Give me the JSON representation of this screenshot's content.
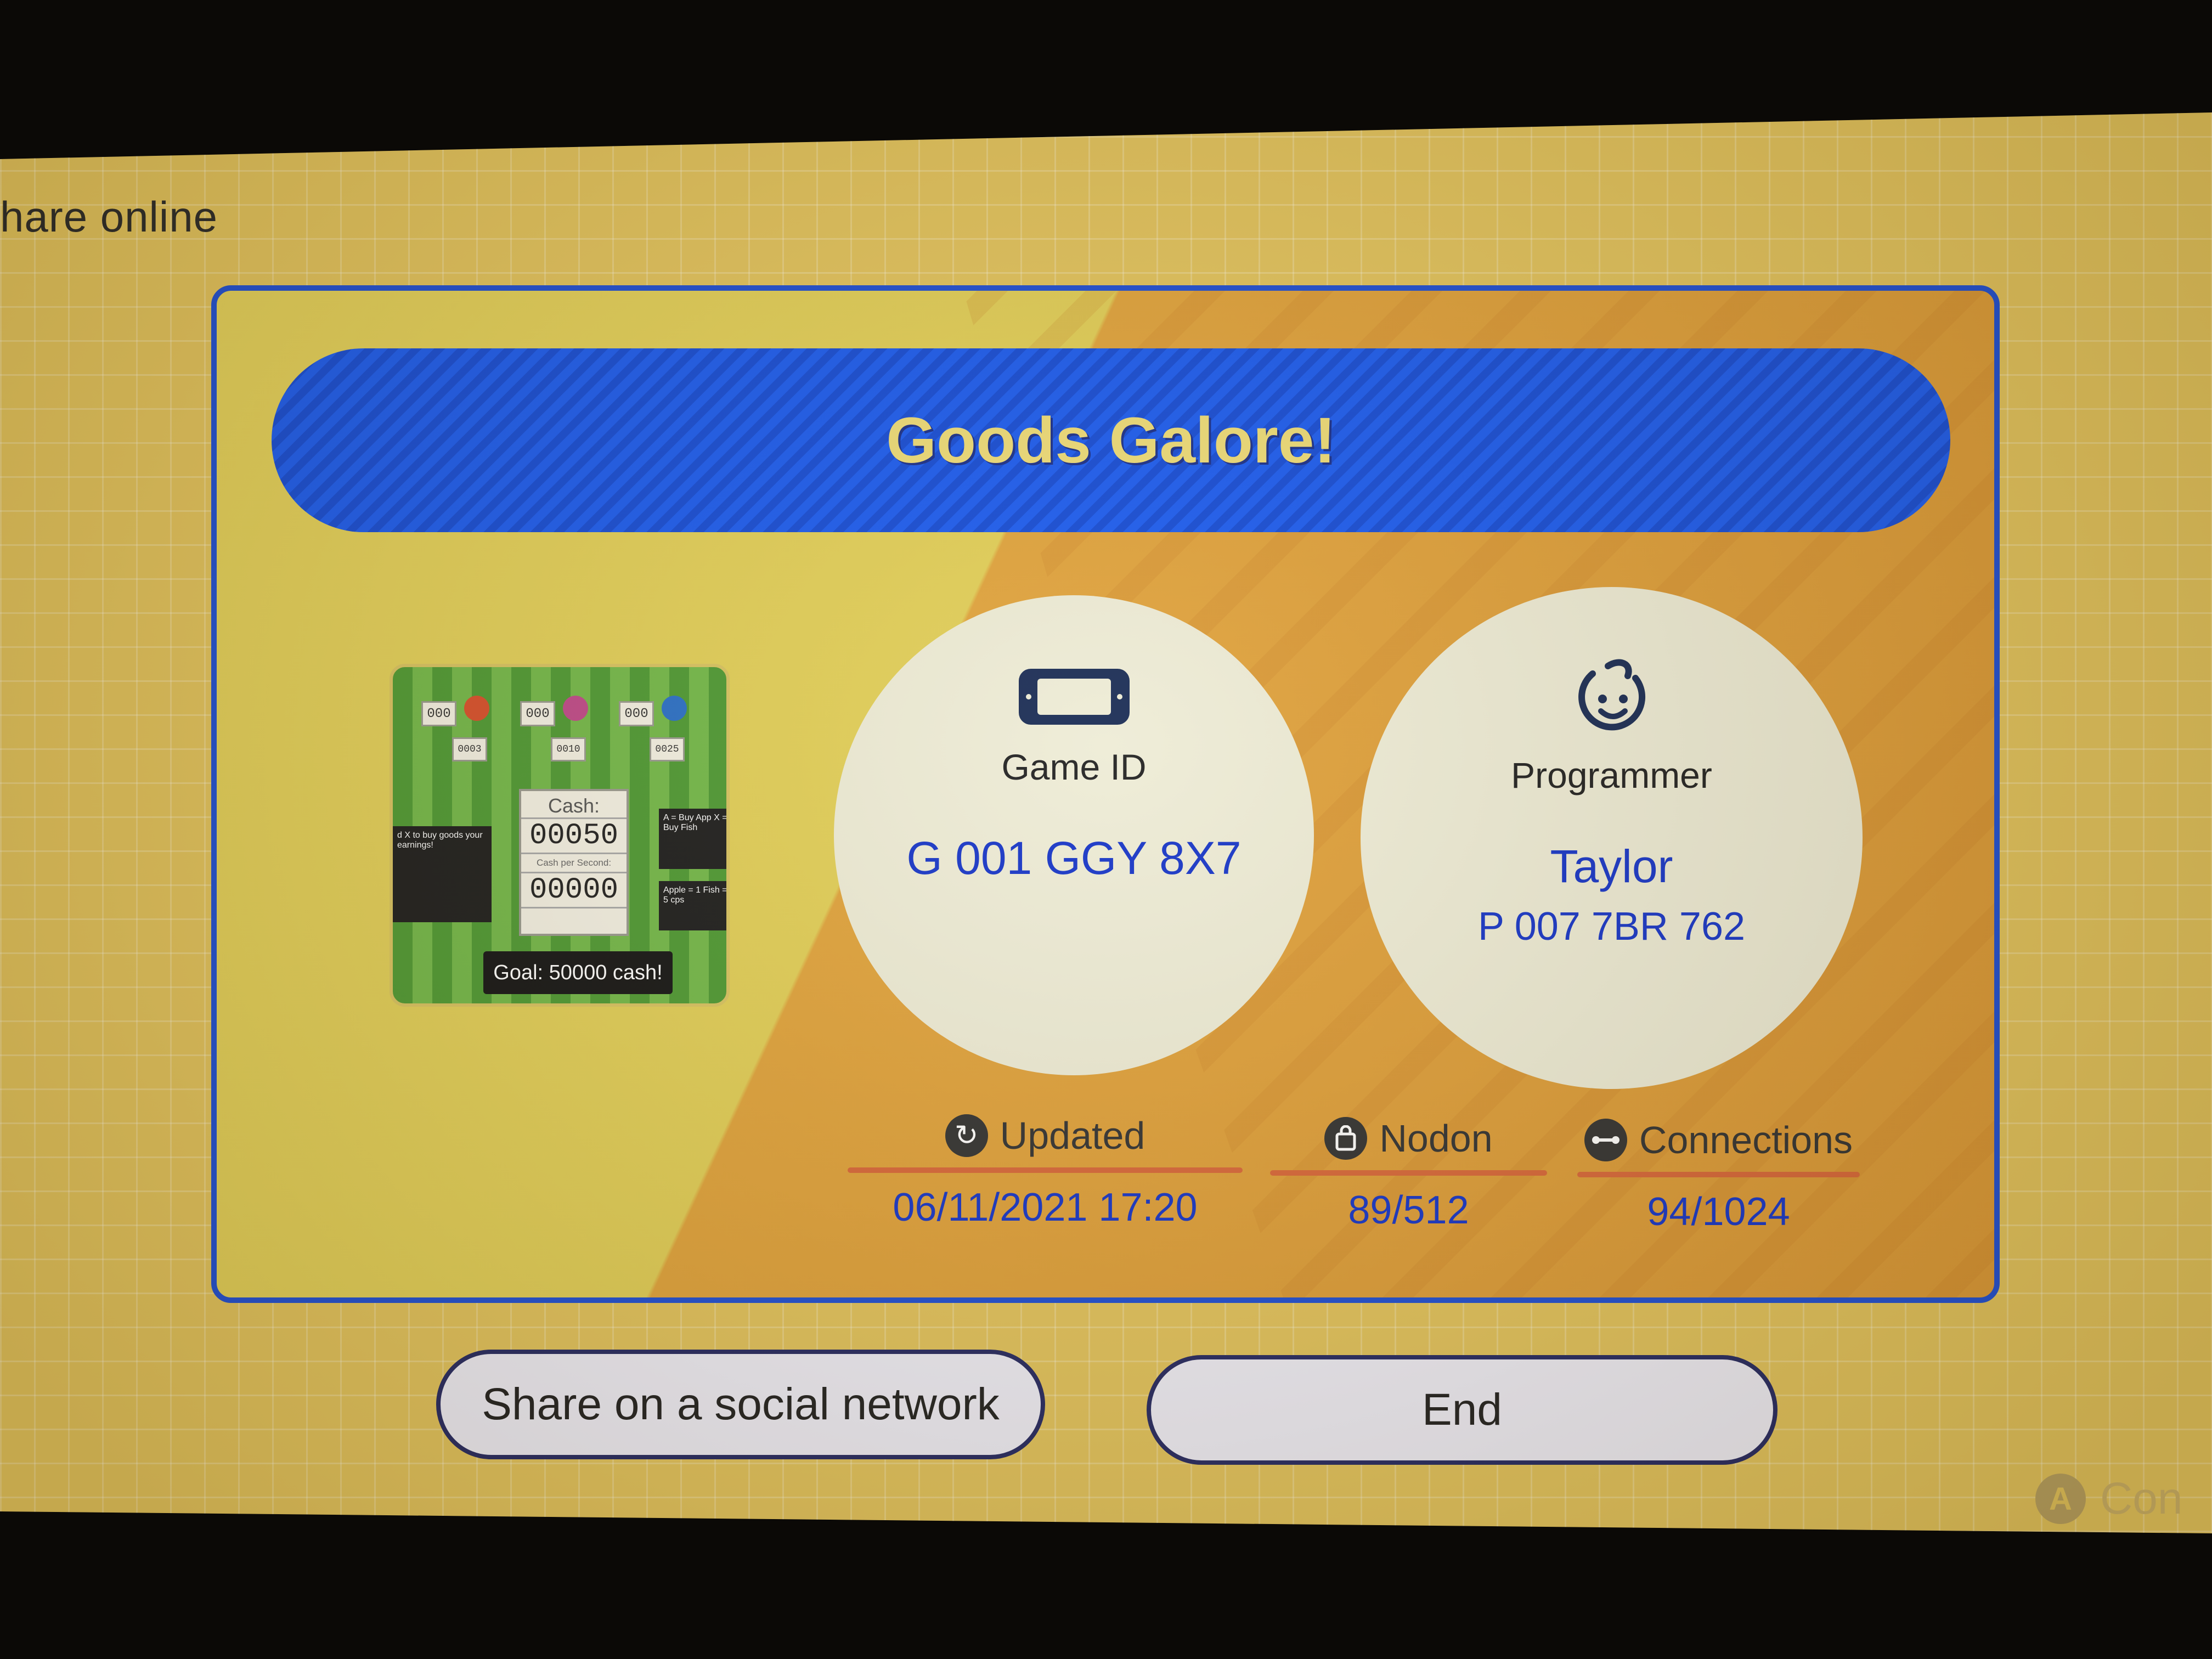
{
  "screen": {
    "title": "hare online"
  },
  "card": {
    "game_title": "Goods Galore!",
    "thumbnail": {
      "top_boxes": [
        "000",
        "000",
        "000"
      ],
      "sub_boxes": [
        "0003",
        "0010",
        "0025"
      ],
      "cash_label": "Cash:",
      "cash_value": "00050",
      "cps_label": "Cash per Second:",
      "cps_value": "00000",
      "left_text": "d X to buy goods your earnings!",
      "right_text_1": "A = Buy App X = Buy Fish",
      "right_text_2": "Apple = 1 Fish = 5 cps",
      "goal": "Goal: 50000 cash!"
    },
    "game_id": {
      "label": "Game ID",
      "value": "G 001 GGY 8X7",
      "icon": "handheld-console-icon"
    },
    "programmer": {
      "label": "Programmer",
      "name": "Taylor",
      "id": "P 007 7BR 762",
      "icon": "smiley-face-icon"
    },
    "stats": {
      "updated_label": "Updated",
      "updated_value": "06/11/2021 17:20",
      "nodon_label": "Nodon",
      "nodon_value": "89/512",
      "connections_label": "Connections",
      "connections_value": "94/1024"
    }
  },
  "buttons": {
    "share": "Share on a social network",
    "end": "End"
  },
  "hint": {
    "key": "A",
    "label": "Con"
  },
  "colors": {
    "background": "#e3c45e",
    "banner": "#1c5cf0",
    "banner_text": "#eedc78",
    "accent_blue_text": "#1736c8",
    "divider": "#d8683a",
    "card_border": "#1f4fd4"
  }
}
